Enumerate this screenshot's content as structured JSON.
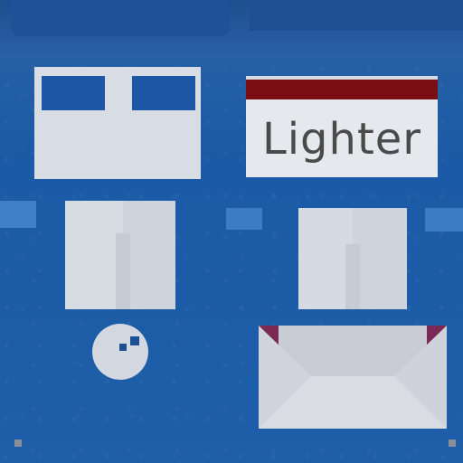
{
  "scene": {
    "label_text": "Lighter",
    "colors": {
      "deep_blue": "#1f5ea8",
      "mid_blue": "#2b66b0",
      "light_blue": "#4e8fd6",
      "panel_gray": "#d9dde6",
      "card_white": "#e6e9ee",
      "stripe_red": "#7a0e14",
      "envelope_purple": "#7b2a55",
      "dot_blue": "#1d4f95"
    }
  }
}
